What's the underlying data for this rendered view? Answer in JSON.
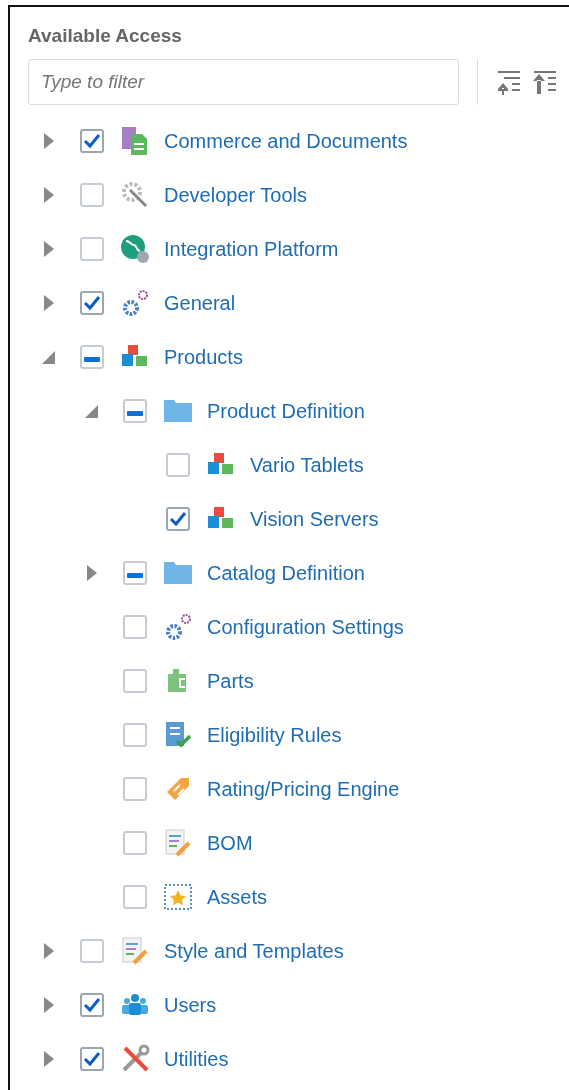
{
  "panel": {
    "title": "Available Access",
    "filter": {
      "placeholder": "Type to filter"
    }
  },
  "tree": [
    {
      "label": "Commerce and Documents",
      "expanded": false,
      "checked": true,
      "indeterminate": false
    },
    {
      "label": "Developer Tools",
      "expanded": false,
      "checked": false,
      "indeterminate": false
    },
    {
      "label": "Integration Platform",
      "expanded": false,
      "checked": false,
      "indeterminate": false
    },
    {
      "label": "General",
      "expanded": false,
      "checked": true,
      "indeterminate": false
    },
    {
      "label": "Products",
      "expanded": true,
      "checked": false,
      "indeterminate": true,
      "children": [
        {
          "label": "Product Definition",
          "expanded": true,
          "checked": false,
          "indeterminate": true,
          "children": [
            {
              "label": "Vario Tablets",
              "checked": false,
              "indeterminate": false
            },
            {
              "label": "Vision Servers",
              "checked": true,
              "indeterminate": false
            }
          ]
        },
        {
          "label": "Catalog Definition",
          "expanded": false,
          "checked": false,
          "indeterminate": true
        },
        {
          "label": "Configuration Settings",
          "checked": false,
          "indeterminate": false
        },
        {
          "label": "Parts",
          "checked": false,
          "indeterminate": false
        },
        {
          "label": "Eligibility Rules",
          "checked": false,
          "indeterminate": false
        },
        {
          "label": "Rating/Pricing Engine",
          "checked": false,
          "indeterminate": false
        },
        {
          "label": "BOM",
          "checked": false,
          "indeterminate": false
        },
        {
          "label": "Assets",
          "checked": false,
          "indeterminate": false
        }
      ]
    },
    {
      "label": "Style and Templates",
      "expanded": false,
      "checked": false,
      "indeterminate": false
    },
    {
      "label": "Users",
      "expanded": false,
      "checked": true,
      "indeterminate": false
    },
    {
      "label": "Utilities",
      "expanded": false,
      "checked": true,
      "indeterminate": false
    }
  ]
}
